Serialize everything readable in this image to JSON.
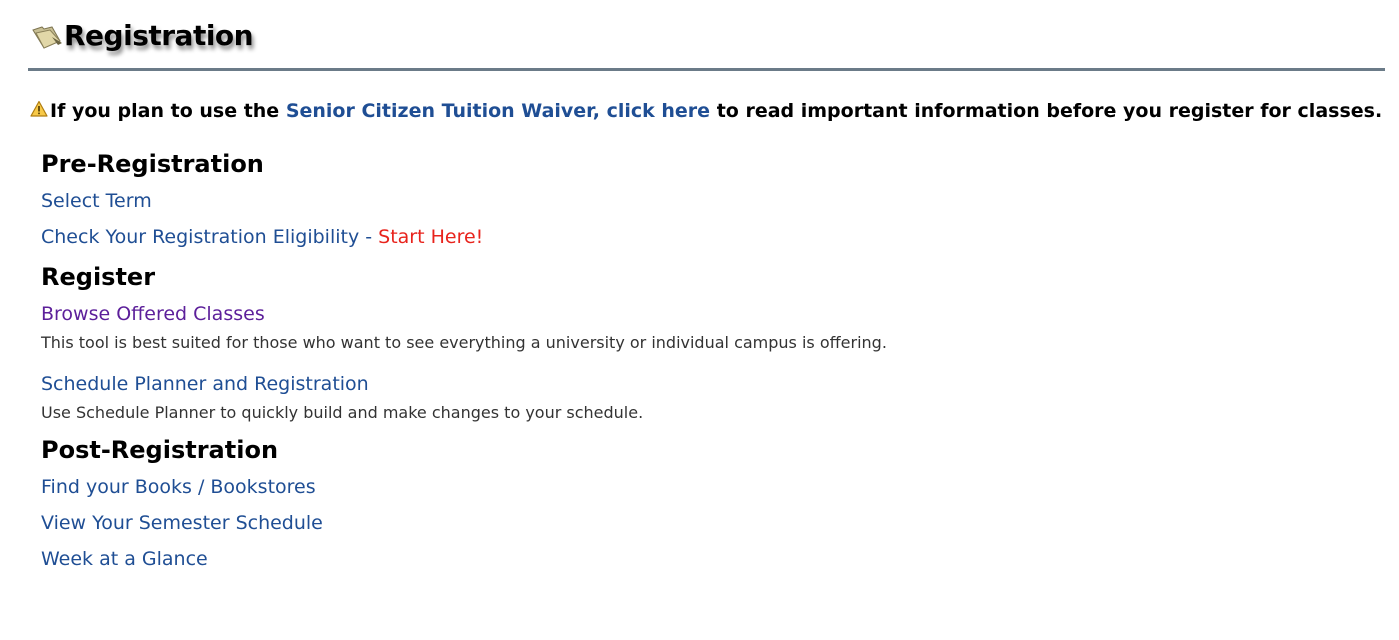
{
  "header": {
    "title": "Registration"
  },
  "notice": {
    "prefix": "If you plan to use the",
    "link_label": "Senior Citizen Tuition Waiver, click here",
    "suffix": "to read important information before you register for classes."
  },
  "sections": {
    "pre_registration": {
      "heading": "Pre-Registration",
      "select_term": "Select Term",
      "eligibility": "Check Your Registration Eligibility",
      "separator": "-",
      "start_here": "Start Here!"
    },
    "register": {
      "heading": "Register",
      "browse_label": "Browse Offered Classes",
      "browse_desc": "This tool is best suited for those who want to see everything a university or individual campus is offering.",
      "planner_label": "Schedule Planner and Registration",
      "planner_desc": "Use Schedule Planner to quickly build and make changes to your schedule."
    },
    "post_registration": {
      "heading": "Post-Registration",
      "books": "Find your Books / Bookstores",
      "schedule": "View Your Semester Schedule",
      "week": "Week at a Glance"
    }
  },
  "colors": {
    "link": "#1f4e94",
    "visited_link": "#5c1f9a",
    "start_here": "#e8231c",
    "divider": "#6b7b88"
  },
  "icons": {
    "header": "folder-icon",
    "notice": "warning-icon"
  }
}
